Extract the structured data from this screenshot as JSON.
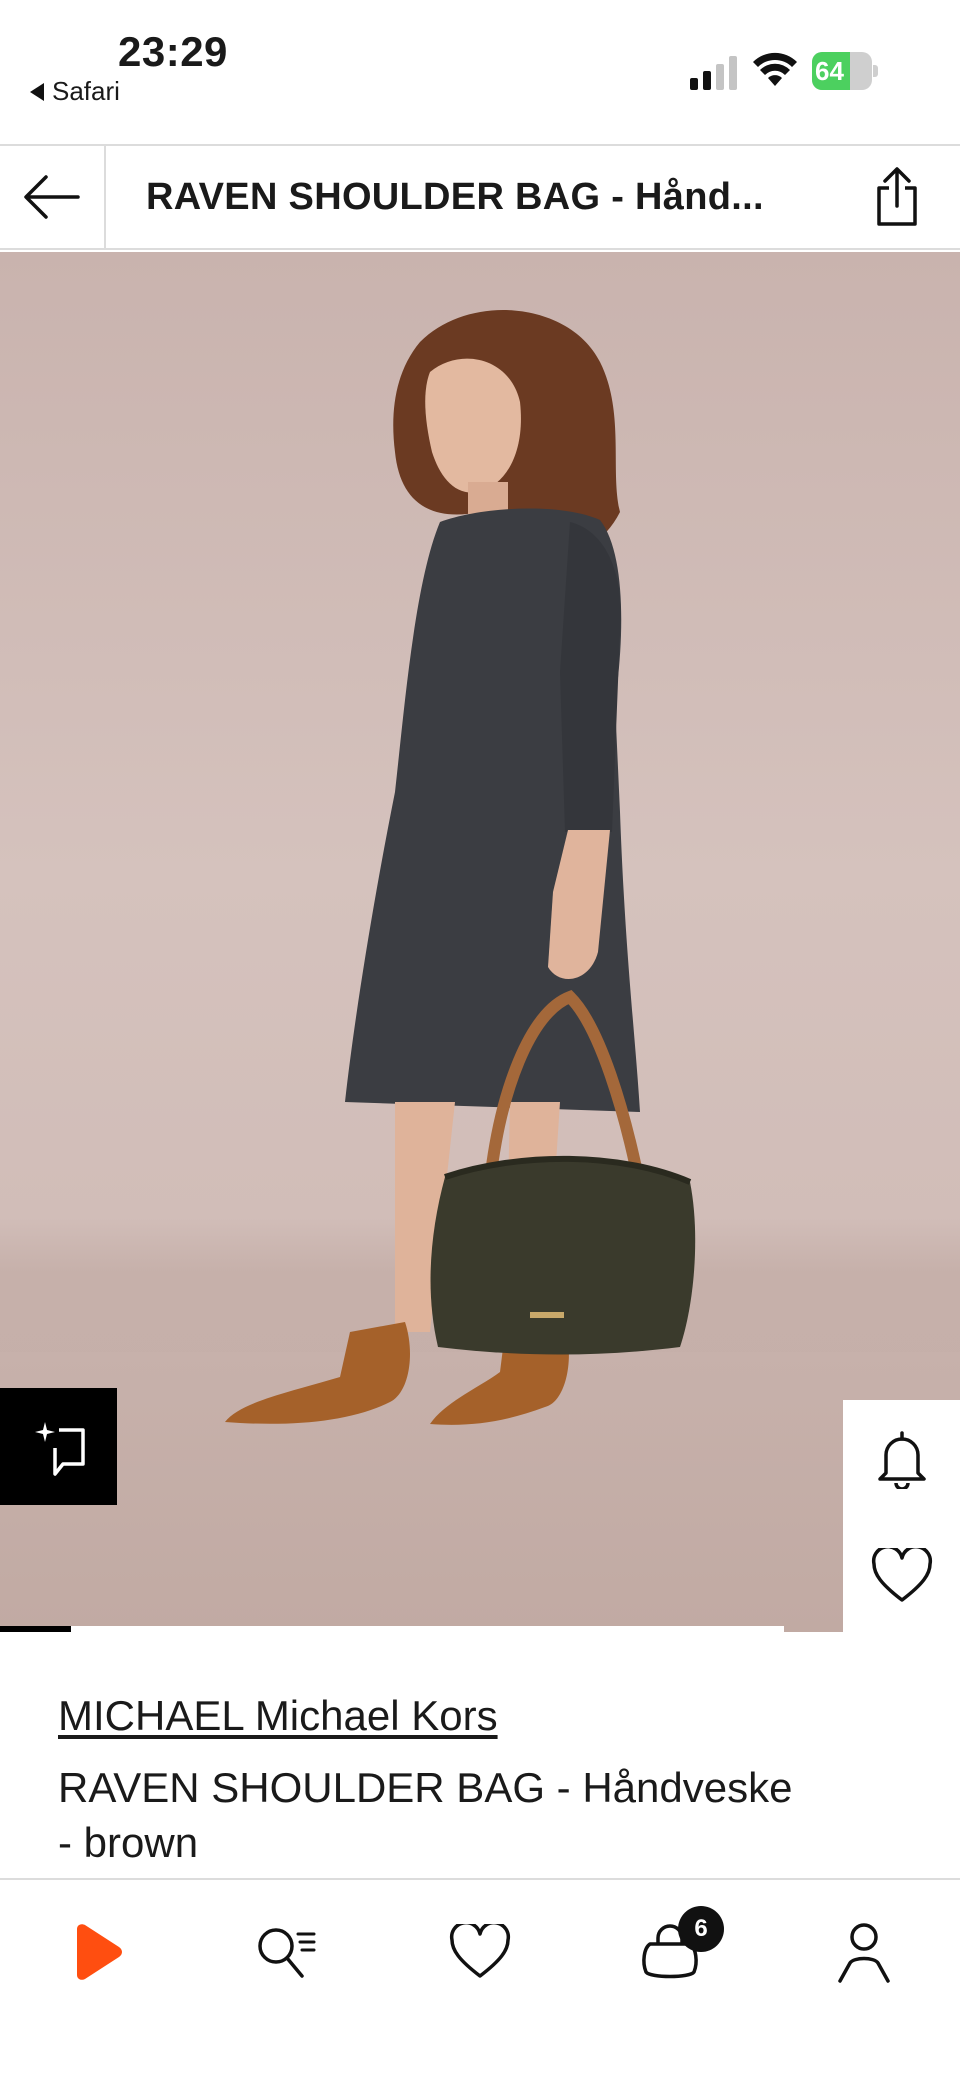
{
  "status_bar": {
    "time": "23:29",
    "back_app_label": "Safari",
    "battery_percent": 64,
    "battery_label": "64",
    "battery_color": "#4cd05f"
  },
  "header": {
    "title": "RAVEN SHOULDER BAG - Hånd...",
    "back_icon": "arrow-left-icon",
    "share_icon": "share-icon"
  },
  "gallery": {
    "progress": 0.09,
    "ai_icon": "sparkle-crop-icon",
    "alert_icon": "bell-icon",
    "wishlist_icon": "heart-icon"
  },
  "product": {
    "brand": "MICHAEL Michael Kors",
    "name": "RAVEN SHOULDER BAG - Håndveske - brown"
  },
  "bottom_nav": {
    "items": [
      {
        "name": "home",
        "icon": "play-logo-icon"
      },
      {
        "name": "search",
        "icon": "search-list-icon"
      },
      {
        "name": "wishlist",
        "icon": "heart-icon"
      },
      {
        "name": "bag",
        "icon": "shopping-bag-icon",
        "badge": "6"
      },
      {
        "name": "account",
        "icon": "person-icon"
      }
    ],
    "accent_color": "#ff4e10"
  }
}
